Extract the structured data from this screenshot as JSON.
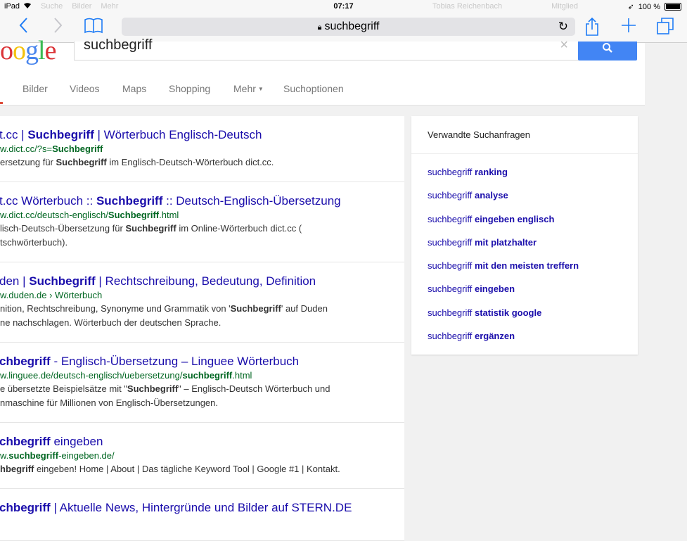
{
  "status_bar": {
    "device": "iPad",
    "ghost_tab_left": "Suche",
    "ghost_tab_left2": "Bilder",
    "ghost_tab_left3": "Mehr",
    "time": "07:17",
    "ghost_user": "Tobias Reichenbach",
    "ghost_button": "Mitglied",
    "battery": "100 %"
  },
  "toolbar": {
    "address": "suchbegriff"
  },
  "google": {
    "logo_letters": [
      "o",
      "o",
      "g",
      "l",
      "e"
    ],
    "query": "suchbegriff"
  },
  "tabs": [
    {
      "label": "Bilder"
    },
    {
      "label": "Videos"
    },
    {
      "label": "Maps"
    },
    {
      "label": "Shopping"
    },
    {
      "label": "Mehr"
    },
    {
      "label": "Suchoptionen"
    }
  ],
  "results": [
    {
      "title_a": "t.cc | ",
      "title_b": "Suchbegriff",
      "title_c": " | Wörterbuch Englisch-Deutsch",
      "url_a": "w.dict.cc/?s=",
      "url_b": "Suchbegriff",
      "url_c": "",
      "snip1_a": "ersetzung für ",
      "snip1_b": "Suchbegriff",
      "snip1_c": " im Englisch-Deutsch-Wörterbuch dict.cc.",
      "snip2": ""
    },
    {
      "title_a": "t.cc Wörterbuch :: ",
      "title_b": "Suchbegriff",
      "title_c": " :: Deutsch-Englisch-Übersetzung",
      "url_a": "w.dict.cc/deutsch-englisch/",
      "url_b": "Suchbegriff",
      "url_c": ".html",
      "snip1_a": "lisch-Deutsch-Übersetzung für ",
      "snip1_b": "Suchbegriff",
      "snip1_c": " im Online-Wörterbuch dict.cc (",
      "snip2": "tschwörterbuch)."
    },
    {
      "title_a": "den | ",
      "title_b": "Suchbegriff",
      "title_c": " | Rechtschreibung, Bedeutung, Definition",
      "url_a": "w.duden.de › Wörterbuch",
      "url_b": "",
      "url_c": "",
      "snip1_a": "nition, Rechtschreibung, Synonyme und Grammatik von '",
      "snip1_b": "Suchbegriff",
      "snip1_c": "' auf Duden",
      "snip2": "ne nachschlagen. Wörterbuch der deutschen Sprache."
    },
    {
      "title_a": "",
      "title_b": "chbegriff",
      "title_c": " - Englisch-Übersetzung – Linguee Wörterbuch",
      "url_a": "w.linguee.de/deutsch-englisch/uebersetzung/",
      "url_b": "suchbegriff",
      "url_c": ".html",
      "snip1_a": "e übersetzte Beispielsätze mit \"",
      "snip1_b": "Suchbegriff",
      "snip1_c": "\" – Englisch-Deutsch Wörterbuch und",
      "snip2": "nmaschine für Millionen von Englisch-Übersetzungen."
    },
    {
      "title_a": "",
      "title_b": "chbegriff",
      "title_c": " eingeben",
      "url_a": "w.",
      "url_b": "suchbegriff",
      "url_c": "-eingeben.de/",
      "snip1_a": "",
      "snip1_b": "hbegriff",
      "snip1_c": " eingeben! Home | About | Das tägliche Keyword Tool | Google #1 | Kontakt.",
      "snip2": ""
    },
    {
      "title_a": "",
      "title_b": "chbegriff",
      "title_c": " | Aktuelle News, Hintergründe und Bilder auf STERN.DE",
      "url_a": "",
      "url_b": "",
      "url_c": "",
      "snip1_a": "",
      "snip1_b": "",
      "snip1_c": "",
      "snip2": ""
    }
  ],
  "related": {
    "header": "Verwandte Suchanfragen",
    "prefix": "suchbegriff ",
    "items": [
      "ranking",
      "analyse",
      "eingeben englisch",
      "mit platzhalter",
      "mit den meisten treffern",
      "eingeben",
      "statistik google",
      "ergänzen"
    ]
  },
  "colors": {
    "link": "#1a0dab",
    "url_green": "#006621",
    "search_blue": "#4285f4",
    "ios_blue": "#1e7cf6"
  }
}
